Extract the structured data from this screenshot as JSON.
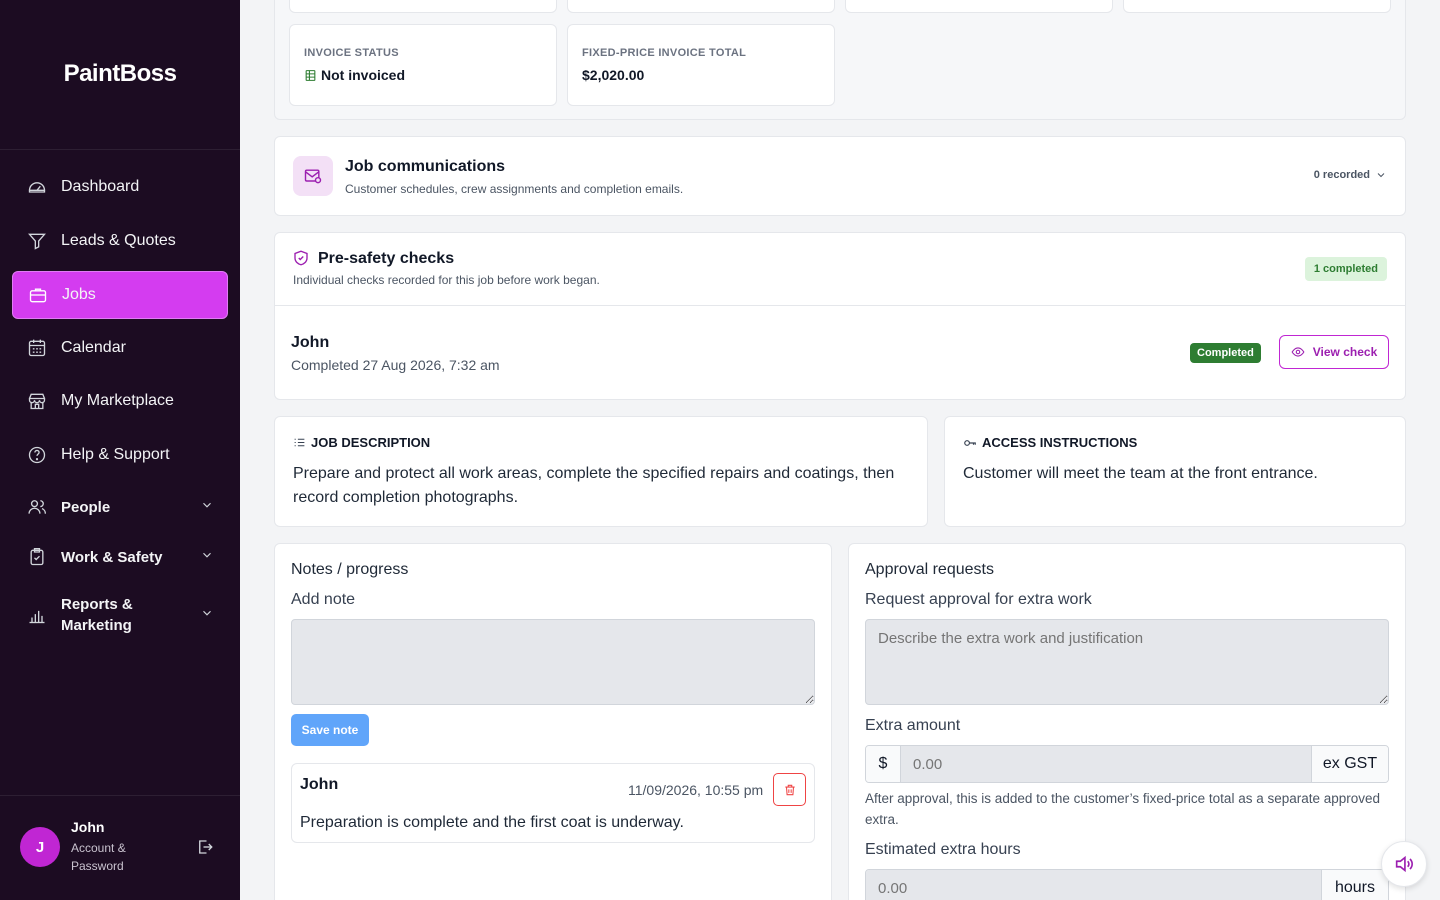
{
  "app": {
    "name": "PaintBoss"
  },
  "colors": {
    "sidebar_bg": "#1c0c22",
    "accent": "#d43cf0",
    "success": "#2e7d32",
    "save_button": "#60a5fa"
  },
  "sidebar": {
    "items": [
      {
        "label": "Dashboard",
        "icon": "dashboard-gauge-icon"
      },
      {
        "label": "Leads & Quotes",
        "icon": "funnel-icon"
      },
      {
        "label": "Jobs",
        "icon": "briefcase-icon",
        "active": true
      },
      {
        "label": "Calendar",
        "icon": "calendar-icon"
      },
      {
        "label": "My Marketplace",
        "icon": "store-icon"
      },
      {
        "label": "Help & Support",
        "icon": "help-circle-icon"
      }
    ],
    "groups": [
      {
        "label": "People",
        "icon": "people-icon"
      },
      {
        "label": "Work & Safety",
        "icon": "clipboard-check-icon"
      },
      {
        "label": "Reports & Marketing",
        "icon": "bar-chart-icon"
      }
    ],
    "user": {
      "initial": "J",
      "name": "John",
      "sub": "Account & Password"
    }
  },
  "summary": {
    "invoice_status_label": "Invoice status",
    "invoice_status_value": "Not invoiced",
    "invoice_total_label": "Fixed-price invoice total",
    "invoice_total_value": "$2,020.00"
  },
  "communications": {
    "title": "Job communications",
    "subtitle": "Customer schedules, crew assignments and completion emails.",
    "count": "0 recorded"
  },
  "safety": {
    "title": "Pre-safety checks",
    "subtitle": "Individual checks recorded for this job before work began.",
    "badge": "1 completed",
    "check": {
      "name": "John",
      "completed": "Completed 27 Aug 2026, 7:32 am",
      "status": "Completed",
      "view_label": "View check"
    }
  },
  "description": {
    "title": "JOB DESCRIPTION",
    "text": "Prepare and protect all work areas, complete the specified repairs and coatings, then record completion photographs."
  },
  "access": {
    "title": "ACCESS INSTRUCTIONS",
    "text": "Customer will meet the team at the front entrance."
  },
  "notes": {
    "title": "Notes / progress",
    "add_label": "Add note",
    "placeholder": "",
    "save_label": "Save note",
    "entries": [
      {
        "author": "John",
        "timestamp": "11/09/2026, 10:55 pm",
        "text": "Preparation is complete and the first coat is underway."
      }
    ]
  },
  "approval": {
    "title": "Approval requests",
    "request_label": "Request approval for extra work",
    "request_placeholder": "Describe the extra work and justification",
    "amount_label": "Extra amount",
    "amount_prefix": "$",
    "amount_placeholder": "0.00",
    "amount_suffix": "ex GST",
    "amount_help": "After approval, this is added to the customer’s fixed-price total as a separate approved extra.",
    "hours_label": "Estimated extra hours",
    "hours_placeholder": "0.00",
    "hours_suffix": "hours"
  }
}
